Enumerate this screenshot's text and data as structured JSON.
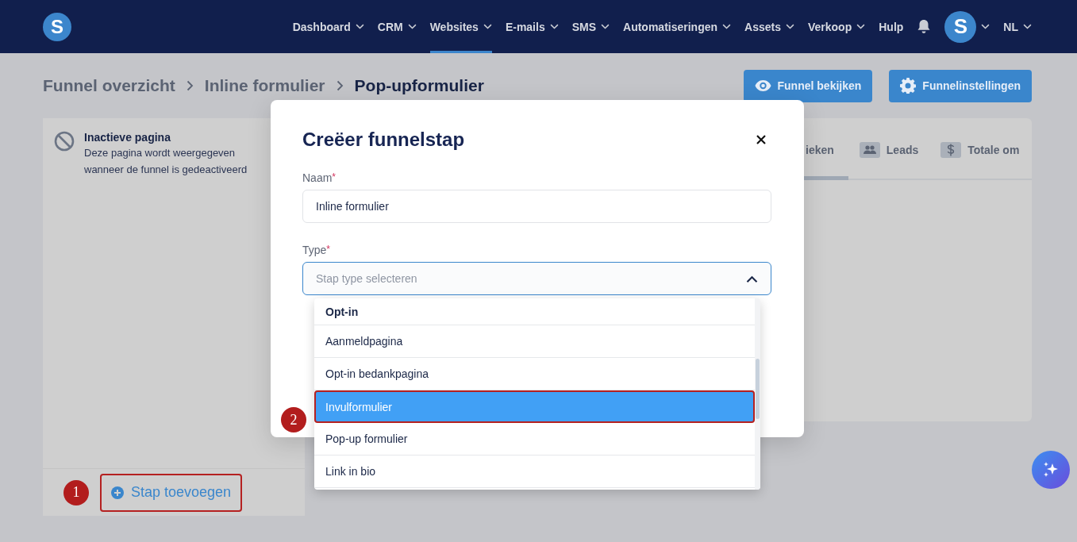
{
  "navbar": {
    "logo_letter": "S",
    "items": [
      {
        "label": "Dashboard",
        "dropdown": true,
        "selected": false
      },
      {
        "label": "CRM",
        "dropdown": true,
        "selected": false
      },
      {
        "label": "Websites",
        "dropdown": true,
        "selected": true
      },
      {
        "label": "E-mails",
        "dropdown": true,
        "selected": false
      },
      {
        "label": "SMS",
        "dropdown": true,
        "selected": false
      },
      {
        "label": "Automatiseringen",
        "dropdown": true,
        "selected": false
      },
      {
        "label": "Assets",
        "dropdown": true,
        "selected": false
      },
      {
        "label": "Verkoop",
        "dropdown": true,
        "selected": false
      },
      {
        "label": "Hulp",
        "dropdown": false,
        "selected": false
      }
    ],
    "avatar_initial": "S",
    "language": "NL"
  },
  "breadcrumb": [
    {
      "label": "Funnel overzicht",
      "current": false
    },
    {
      "label": "Inline formulier",
      "current": false
    },
    {
      "label": "Pop-upformulier",
      "current": true
    }
  ],
  "header_buttons": [
    {
      "kind": "view",
      "label": "Funnel bekijken"
    },
    {
      "kind": "settings",
      "label": "Funnelinstellingen"
    }
  ],
  "steps_panel": {
    "inactive_page": {
      "title": "Inactieve pagina",
      "description": "Deze pagina wordt weergegeven wanneer de funnel is gedeactiveerd"
    },
    "add_step_button": {
      "label": "Stap toevoegen",
      "callout": "1"
    }
  },
  "stats_panel": {
    "tabs": [
      {
        "kind": "text",
        "label": "ieken",
        "selected": true
      },
      {
        "kind": "people",
        "label": "Leads",
        "selected": false
      },
      {
        "kind": "dollar",
        "label": "Totale om",
        "selected": false
      }
    ]
  },
  "modal": {
    "title": "Creëer funnelstap",
    "fields": [
      {
        "label": "Naam",
        "required_mark": "*",
        "kind": "text",
        "value": "Inline formulier"
      },
      {
        "label": "Type",
        "required_mark": "*",
        "kind": "select",
        "placeholder": "Stap type selecteren",
        "expanded": true
      }
    ],
    "dropdown_options": [
      {
        "kind": "header",
        "label": "Opt-in",
        "selected": false
      },
      {
        "kind": "option",
        "label": "Aanmeldpagina",
        "selected": false
      },
      {
        "kind": "option",
        "label": "Opt-in bedankpagina",
        "selected": false
      },
      {
        "kind": "option",
        "label": "Invulformulier",
        "selected": true,
        "callout": "2"
      },
      {
        "kind": "option",
        "label": "Pop-up formulier",
        "selected": false
      },
      {
        "kind": "option",
        "label": "Link in bio",
        "selected": false
      }
    ]
  }
}
